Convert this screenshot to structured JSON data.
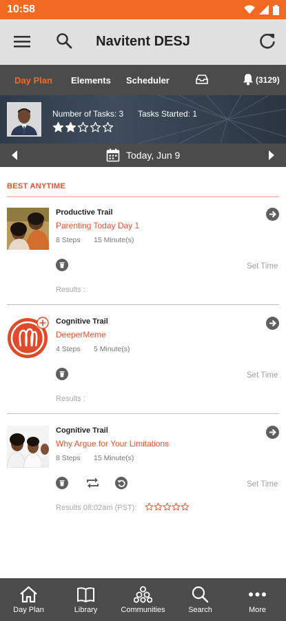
{
  "status": {
    "time": "10:58"
  },
  "app": {
    "title": "Navitent DESJ"
  },
  "tabs": [
    {
      "label": "Day Plan",
      "active": true
    },
    {
      "label": "Elements",
      "active": false
    },
    {
      "label": "Scheduler",
      "active": false
    }
  ],
  "notifications": {
    "count": "(3129)"
  },
  "banner": {
    "tasks_label": "Number of Tasks: 3",
    "started_label": "Tasks Started: 1",
    "rating": 2,
    "rating_max": 5
  },
  "date": {
    "label": "Today, Jun 9"
  },
  "section": {
    "title": "BEST ANYTIME"
  },
  "tasks": [
    {
      "trail": "Productive Trail",
      "name": "Parenting Today Day 1",
      "steps": "8 Steps",
      "duration": "15 Minute(s)",
      "set_time": "Set Time",
      "results": "Results :"
    },
    {
      "trail": "Cognitive Trail",
      "name": "DeeperMeme",
      "steps": "4 Steps",
      "duration": "5 Minute(s)",
      "set_time": "Set Time",
      "results": "Results :"
    },
    {
      "trail": "Cognitive Trail",
      "name": "Why Argue for Your Limitations",
      "steps": "8 Steps",
      "duration": "15 Minute(s)",
      "set_time": "Set Time",
      "results": "Results 08:02am (PST):",
      "result_rating": 0,
      "result_rating_max": 5
    }
  ],
  "bottom_nav": [
    {
      "label": "Day Plan",
      "icon": "home-icon"
    },
    {
      "label": "Library",
      "icon": "book-icon"
    },
    {
      "label": "Communities",
      "icon": "communities-icon"
    },
    {
      "label": "Search",
      "icon": "search-icon"
    },
    {
      "label": "More",
      "icon": "more-dots-icon"
    }
  ],
  "colors": {
    "accent": "#f26a21",
    "link": "#e8502c",
    "bar": "#4b4b4b",
    "appbar": "#e0e0e0"
  }
}
